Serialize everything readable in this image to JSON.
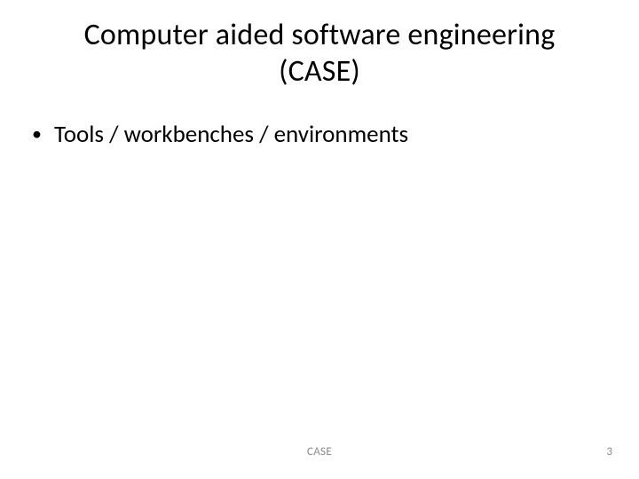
{
  "title_line1": "Computer aided software engineering",
  "title_line2": "(CASE)",
  "bullets": {
    "item0": "Tools / workbenches / environments"
  },
  "footer": {
    "center": "CASE",
    "page": "3"
  }
}
